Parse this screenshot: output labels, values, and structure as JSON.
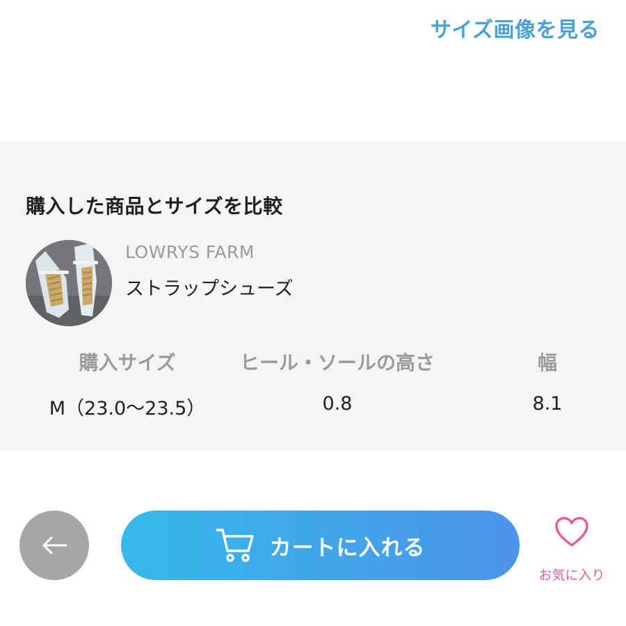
{
  "header": {
    "size_image_link": "サイズ画像を見る"
  },
  "compare": {
    "title": "購入した商品とサイズを比較",
    "brand": "LOWRYS FARM",
    "product_name": "ストラップシューズ",
    "columns": [
      {
        "header": "購入サイズ",
        "value": "M（23.0～23.5）"
      },
      {
        "header": "ヒール・ソールの高さ",
        "value": "0.8"
      },
      {
        "header": "幅",
        "value": "8.1"
      }
    ]
  },
  "footer": {
    "cart_label": "カートに入れる",
    "favorite_label": "お気に入り"
  },
  "colors": {
    "link": "#4a9fd6",
    "panel_bg": "#f5f5f6",
    "cart_gradient_start": "#35b9ea",
    "cart_gradient_end": "#4c93e8",
    "back_button": "#a6a6a6",
    "favorite": "#e0609a"
  },
  "icons": {
    "back": "arrow-left-icon",
    "cart": "shopping-cart-icon",
    "favorite": "heart-outline-icon"
  }
}
